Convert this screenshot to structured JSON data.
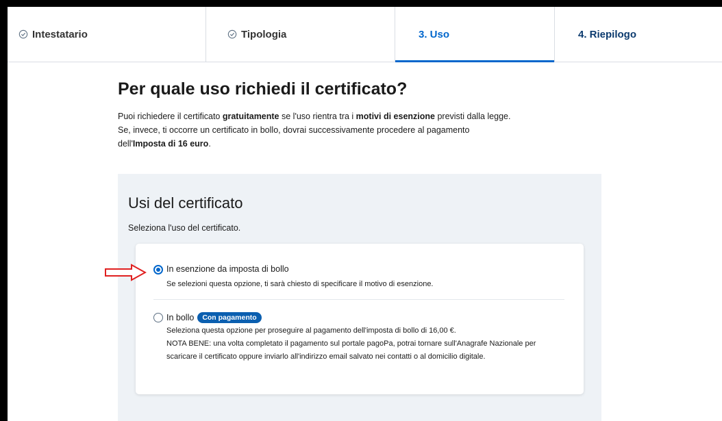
{
  "steps": [
    {
      "label": "Intestatario",
      "state": "done"
    },
    {
      "label": "Tipologia",
      "state": "done"
    },
    {
      "label": "3. Uso",
      "state": "active"
    },
    {
      "label": "4. Riepilogo",
      "state": "pending"
    }
  ],
  "page": {
    "title": "Per quale uso richiedi il certificato?",
    "intro_1a": "Puoi richiedere il certificato ",
    "intro_1b": "gratuitamente",
    "intro_1c": " se l'uso rientra tra i ",
    "intro_1d": "motivi di esenzione",
    "intro_1e": " previsti dalla legge.",
    "intro_2": "Se, invece, ti occorre un certificato in bollo, dovrai successivamente procedere al pagamento",
    "intro_3a": "dell'",
    "intro_3b": "Imposta di 16 euro",
    "intro_3c": "."
  },
  "uses": {
    "title": "Usi del certificato",
    "subtitle": "Seleziona l'uso del certificato.",
    "options": [
      {
        "label": "In esenzione da imposta di bollo",
        "description": "Se selezioni questa opzione, ti sarà chiesto di specificare il motivo di esenzione.",
        "selected": true
      },
      {
        "label": "In bollo",
        "badge": "Con pagamento",
        "desc_1": "Seleziona questa opzione per proseguire al pagamento dell'imposta di bollo di 16,00 €.",
        "desc_2": "NOTA BENE: una volta completato il pagamento sul portale pagoPa, potrai tornare sull'Anagrafe Nazionale per",
        "desc_3": "scaricare il certificato oppure inviarlo all'indirizzo email salvato nei contatti o al domicilio digitale.",
        "selected": false
      }
    ]
  },
  "colors": {
    "accent": "#0066cc",
    "badge": "#0b5fb0",
    "panel": "#eef2f6",
    "annotation_arrow": "#e02020"
  },
  "icons": {
    "completed_step": "check-circle-icon",
    "annotation": "red-arrow-icon"
  }
}
